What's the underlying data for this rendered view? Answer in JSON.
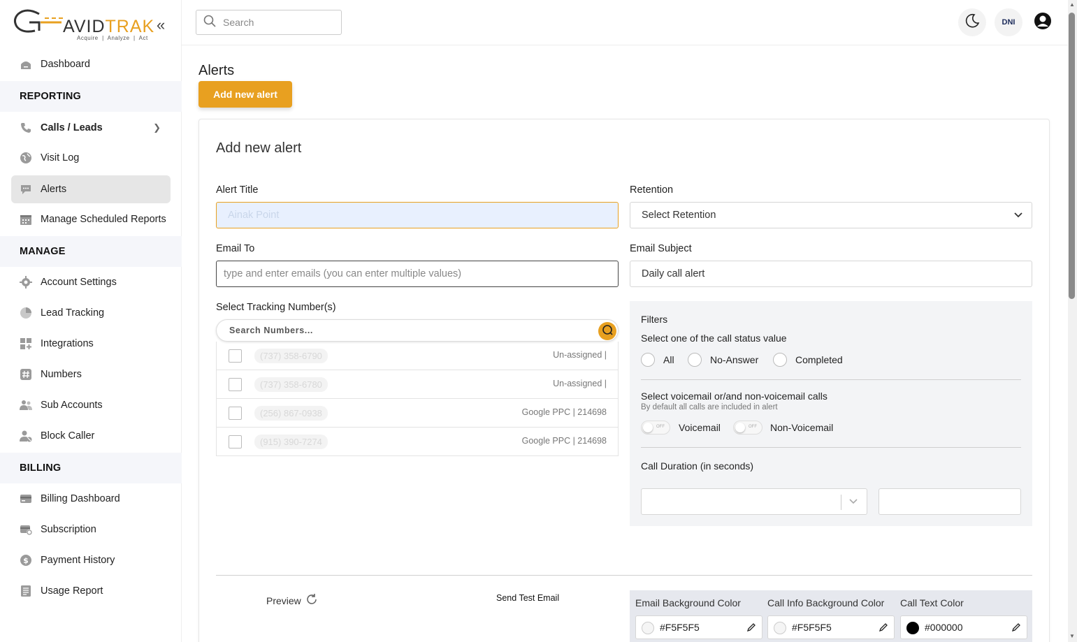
{
  "logo": {
    "brand_part1": "AVID",
    "brand_part2": "TRAK",
    "tagline": "Acquire  |  Analyze  |  Act"
  },
  "sidebar": {
    "dashboard": "Dashboard",
    "sections": {
      "reporting": "REPORTING",
      "manage": "MANAGE",
      "billing": "BILLING"
    },
    "items": {
      "calls_leads": "Calls / Leads",
      "visit_log": "Visit Log",
      "alerts": "Alerts",
      "manage_scheduled_reports": "Manage Scheduled Reports",
      "account_settings": "Account Settings",
      "lead_tracking": "Lead Tracking",
      "integrations": "Integrations",
      "numbers": "Numbers",
      "sub_accounts": "Sub Accounts",
      "block_caller": "Block Caller",
      "billing_dashboard": "Billing Dashboard",
      "subscription": "Subscription",
      "payment_history": "Payment History",
      "usage_report": "Usage Report"
    },
    "active": "Alerts"
  },
  "topbar": {
    "search_placeholder": "Search",
    "dni_label": "DNI"
  },
  "page": {
    "title": "Alerts",
    "add_button": "Add new alert"
  },
  "form": {
    "card_title": "Add new alert",
    "alert_title_label": "Alert Title",
    "alert_title_value": "Ainak Point",
    "retention_label": "Retention",
    "retention_value": "Select Retention",
    "email_to_label": "Email To",
    "email_to_placeholder": "type and enter emails (you can enter multiple values)",
    "email_subject_label": "Email Subject",
    "email_subject_value": "Daily call alert",
    "tracking_label": "Select Tracking Number(s)",
    "search_numbers_placeholder": "Search Numbers...",
    "numbers": [
      {
        "number": "(737) 358-6790",
        "source": "Un-assigned |"
      },
      {
        "number": "(737) 358-6780",
        "source": "Un-assigned |"
      },
      {
        "number": "(256) 867-0938",
        "source": "Google PPC | 214698"
      },
      {
        "number": "(915) 390-7274",
        "source": "Google PPC | 214698"
      }
    ]
  },
  "filters": {
    "title": "Filters",
    "status_prompt": "Select one of the call status value",
    "status_options": [
      "All",
      "No-Answer",
      "Completed"
    ],
    "voicemail_prompt": "Select voicemail or/and non-voicemail calls",
    "voicemail_note": "By default all calls are included in alert",
    "toggle_off_text": "OFF",
    "voicemail_label": "Voicemail",
    "non_voicemail_label": "Non-Voicemail",
    "duration_label": "Call Duration (in seconds)"
  },
  "preview": {
    "preview_label": "Preview",
    "send_test_label": "Send Test Email"
  },
  "colors": {
    "email_bg_label": "Email Background Color",
    "email_bg_value": "#F5F5F5",
    "call_info_bg_label": "Call Info Background Color",
    "call_info_bg_value": "#F5F5F5",
    "call_text_label": "Call Text Color",
    "call_text_value": "#000000",
    "accent": "#E8A020"
  }
}
